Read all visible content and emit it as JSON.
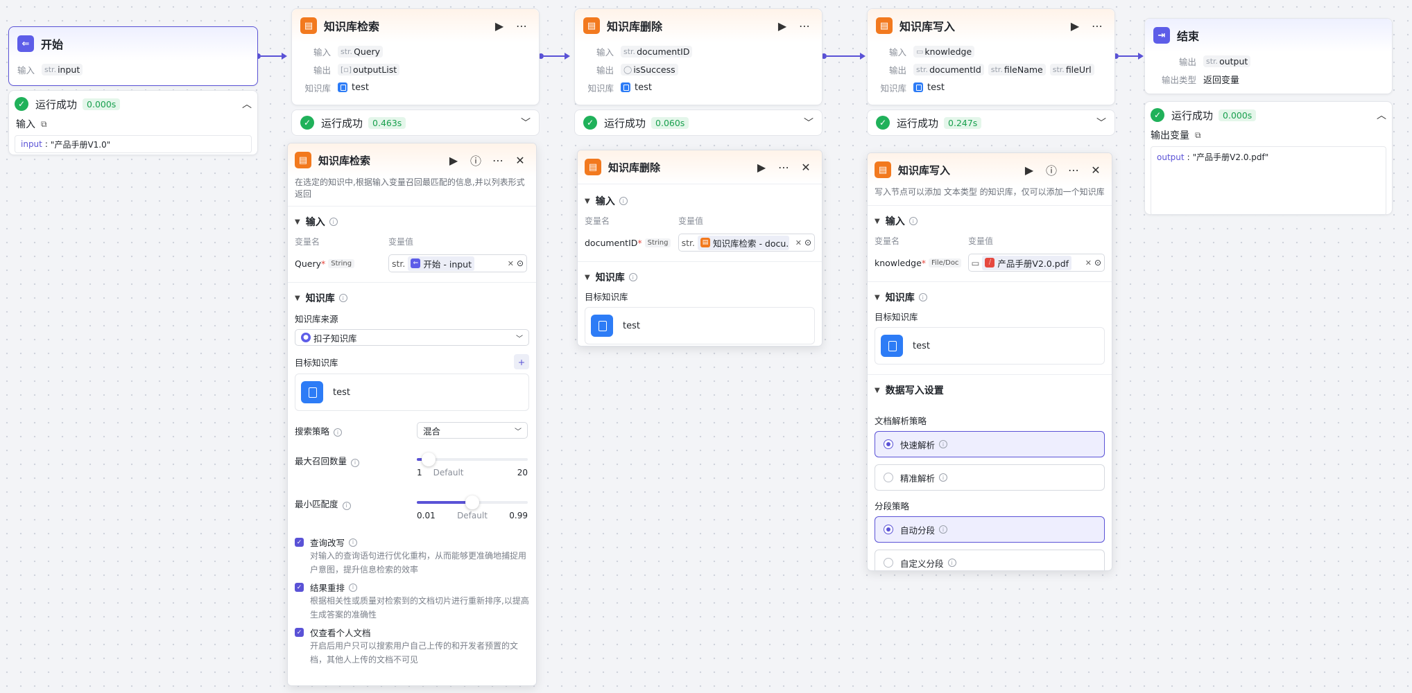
{
  "start": {
    "title": "开始",
    "input_label": "输入",
    "var_type": "str.",
    "var_name": "input",
    "run": {
      "status": "运行成功",
      "time": "0.000s",
      "section": "输入",
      "key": "input",
      "value": "\"产品手册V1.0\""
    }
  },
  "search_node": {
    "title": "知识库检索",
    "in_label": "输入",
    "in_type": "str.",
    "in_var": "Query",
    "out_label": "输出",
    "out_type": "[▫]",
    "out_var": "outputList",
    "kb_label": "知识库",
    "kb_name": "test",
    "run": {
      "status": "运行成功",
      "time": "0.463s"
    }
  },
  "delete_node": {
    "title": "知识库删除",
    "in_label": "输入",
    "in_type": "str.",
    "in_var": "documentID",
    "out_label": "输出",
    "out_type": "◯",
    "out_var": "isSuccess",
    "kb_label": "知识库",
    "kb_name": "test",
    "run": {
      "status": "运行成功",
      "time": "0.060s"
    }
  },
  "write_node": {
    "title": "知识库写入",
    "in_label": "输入",
    "in_var": "knowledge",
    "out_label": "输出",
    "out_type": "str.",
    "out_vars": [
      "documentId",
      "fileName",
      "fileUrl"
    ],
    "kb_label": "知识库",
    "kb_name": "test",
    "run": {
      "status": "运行成功",
      "time": "0.247s"
    }
  },
  "end": {
    "title": "结束",
    "out_label": "输出",
    "var_type": "str.",
    "var_name": "output",
    "out_type_label": "输出类型",
    "out_type_value": "返回变量",
    "run": {
      "status": "运行成功",
      "time": "0.000s",
      "section": "输出变量",
      "key": "output",
      "value": "\"产品手册V2.0.pdf\""
    }
  },
  "search_panel": {
    "title": "知识库检索",
    "desc": "在选定的知识中,根据输入变量召回最匹配的信息,并以列表形式返回",
    "input_section": "输入",
    "col_name": "变量名",
    "col_value": "变量值",
    "var_name": "Query",
    "var_type": "String",
    "ref_prefix": "str.",
    "ref_text": "开始 - input",
    "kb_section": "知识库",
    "source_label": "知识库来源",
    "source_value": "扣子知识库",
    "target_label": "目标知识库",
    "target_name": "test",
    "strategy_label": "搜索策略",
    "strategy_value": "混合",
    "max_label": "最大召回数量",
    "max_min": "1",
    "max_default": "Default",
    "max_max": "20",
    "max_value": 3,
    "min_label": "最小匹配度",
    "min_min": "0.01",
    "min_default": "Default",
    "min_max": "0.99",
    "min_value": 0.5,
    "checks": [
      {
        "label": "查询改写",
        "desc": "对输入的查询语句进行优化重构，从而能够更准确地捕捉用户意图，提升信息检索的效率",
        "checked": true
      },
      {
        "label": "结果重排",
        "desc": "根据相关性或质量对检索到的文档切片进行重新排序,以提高生成答案的准确性",
        "checked": true
      },
      {
        "label": "仅查看个人文档",
        "desc": "开启后用户只可以搜索用户自己上传的和开发者预置的文档，其他人上传的文档不可见",
        "checked": true
      }
    ]
  },
  "delete_panel": {
    "title": "知识库删除",
    "input_section": "输入",
    "col_name": "变量名",
    "col_value": "变量值",
    "var_name": "documentID",
    "var_type": "String",
    "ref_prefix": "str.",
    "ref_text": "知识库检索 - docu...",
    "kb_section": "知识库",
    "target_label": "目标知识库",
    "target_name": "test"
  },
  "write_panel": {
    "title": "知识库写入",
    "desc": "写入节点可以添加 文本类型 的知识库，仅可以添加一个知识库",
    "input_section": "输入",
    "col_name": "变量名",
    "col_value": "变量值",
    "var_name": "knowledge",
    "var_type": "File/Doc",
    "file_name": "产品手册V2.0.pdf",
    "kb_section": "知识库",
    "target_label": "目标知识库",
    "target_name": "test",
    "write_section": "数据写入设置",
    "parse_label": "文档解析策略",
    "parse_options": [
      "快速解析",
      "精准解析"
    ],
    "chunk_label": "分段策略",
    "chunk_options": [
      "自动分段",
      "自定义分段"
    ]
  },
  "colors": {
    "accent": "#5a52d6",
    "kb_orange": "#f2791e",
    "kb_blue": "#2d7cf6",
    "success": "#20b15a"
  }
}
